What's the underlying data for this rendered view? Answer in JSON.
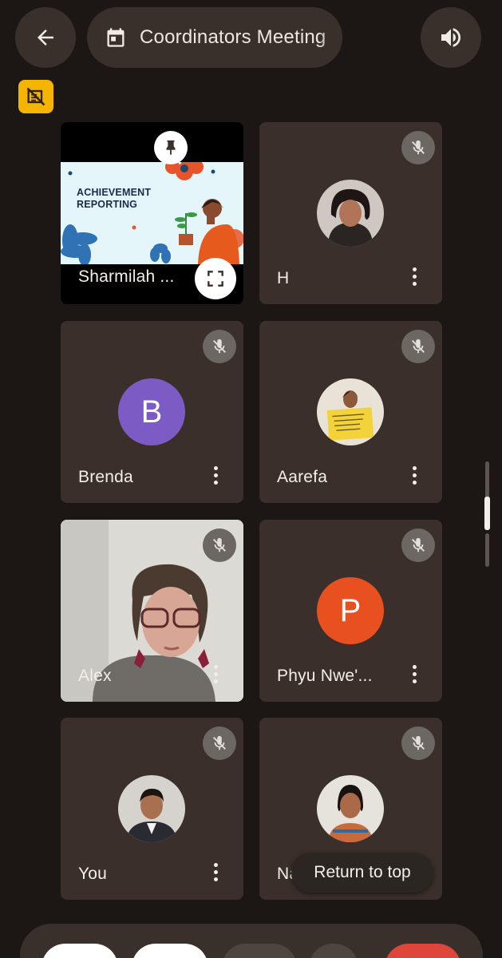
{
  "header": {
    "meeting_title": "Coordinators Meeting",
    "icons": {
      "back": "arrow-left-icon",
      "calendar": "calendar-icon",
      "audio": "speaker-icon",
      "warning": "no-connection-icon"
    }
  },
  "tiles": [
    {
      "name": "Sharmilah ...",
      "kind": "presentation",
      "slide_text": "ACHIEVEMENT REPORTING"
    },
    {
      "name": "H",
      "kind": "photo"
    },
    {
      "name": "Brenda",
      "kind": "letter",
      "letter": "B",
      "color": "#7c5cc4"
    },
    {
      "name": "Aarefa",
      "kind": "photo"
    },
    {
      "name": "Alex",
      "kind": "video"
    },
    {
      "name": "Phyu Nwe'...",
      "kind": "letter",
      "letter": "P",
      "color": "#e8501f"
    },
    {
      "name": "You",
      "kind": "photo"
    },
    {
      "name": "Na",
      "kind": "photo"
    }
  ],
  "toast": {
    "label": "Return to top"
  },
  "colors": {
    "bg": "#1c1715",
    "tile": "#3a2f2a",
    "pill": "#3a302b",
    "warning": "#f5b400",
    "end_call": "#e0453a"
  }
}
